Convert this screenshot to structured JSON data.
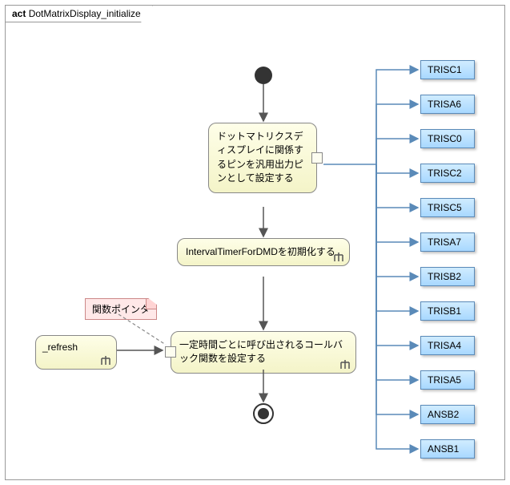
{
  "frame": {
    "prefix": "act",
    "title": "DotMatrixDisplay_initialize"
  },
  "activities": {
    "act1": "ドットマトリクスディスプレイに関係するピンを汎用出力ピンとして設定する",
    "act2": "IntervalTimerForDMDを初期化する",
    "act3": "一定時間ごとに呼び出されるコールバック関数を設定する"
  },
  "note": "関数ポインタ",
  "refresh": "_refresh",
  "refs": [
    "TRISC1",
    "TRISA6",
    "TRISC0",
    "TRISC2",
    "TRISC5",
    "TRISA7",
    "TRISB2",
    "TRISB1",
    "TRISA4",
    "TRISA5",
    "ANSB2",
    "ANSB1"
  ]
}
